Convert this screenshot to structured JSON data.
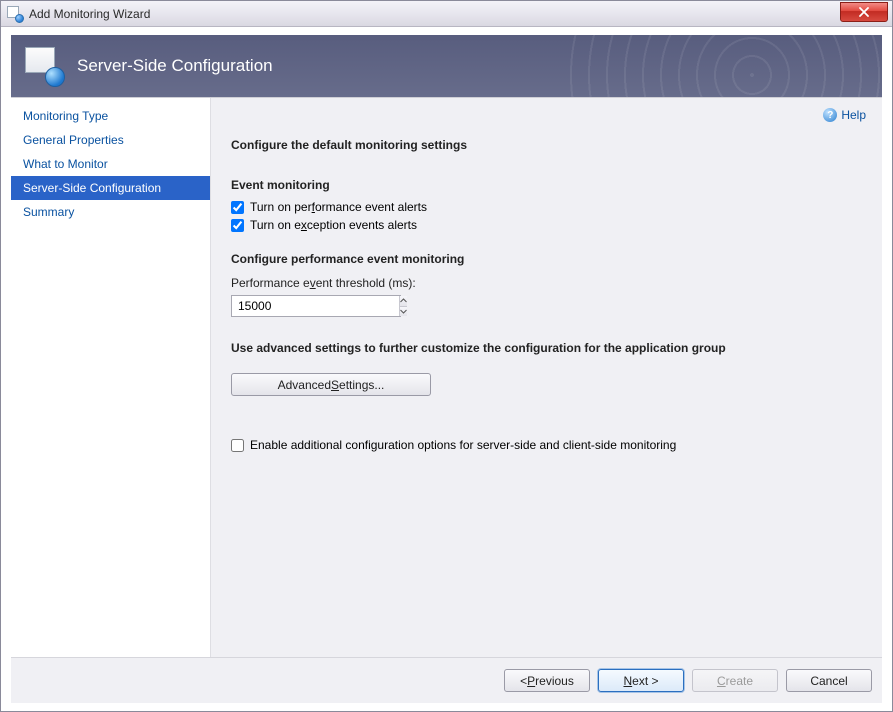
{
  "window": {
    "title": "Add Monitoring Wizard"
  },
  "header": {
    "title": "Server-Side Configuration"
  },
  "help": {
    "label": "Help"
  },
  "sidebar": {
    "items": [
      {
        "label": "Monitoring Type",
        "selected": false
      },
      {
        "label": "General Properties",
        "selected": false
      },
      {
        "label": "What to Monitor",
        "selected": false
      },
      {
        "label": "Server-Side Configuration",
        "selected": true
      },
      {
        "label": "Summary",
        "selected": false
      }
    ]
  },
  "main": {
    "heading": "Configure the default monitoring settings",
    "event_monitoring": {
      "title": "Event monitoring",
      "perf_alerts_prefix": "Turn on per",
      "perf_alerts_ukey": "f",
      "perf_alerts_suffix": "ormance event alerts",
      "perf_alerts_checked": true,
      "exc_alerts_prefix": "Turn on e",
      "exc_alerts_ukey": "x",
      "exc_alerts_suffix": "ception events alerts",
      "exc_alerts_checked": true
    },
    "perf_config": {
      "title": "Configure performance event monitoring",
      "threshold_prefix": "Performance e",
      "threshold_ukey": "v",
      "threshold_suffix": "ent threshold (ms):",
      "threshold_value": "15000"
    },
    "advanced": {
      "title": "Use advanced settings to further customize the configuration for the application group",
      "btn_prefix": "Advanced ",
      "btn_ukey": "S",
      "btn_suffix": "ettings..."
    },
    "extra": {
      "enable_additional_label": "Enable additional configuration options for server-side and client-side monitoring",
      "enable_additional_checked": false
    }
  },
  "footer": {
    "previous_prefix": "< ",
    "previous_ukey": "P",
    "previous_suffix": "revious",
    "next_ukey": "N",
    "next_suffix": "ext >",
    "create_ukey": "C",
    "create_suffix": "reate",
    "cancel_label": "Cancel"
  }
}
